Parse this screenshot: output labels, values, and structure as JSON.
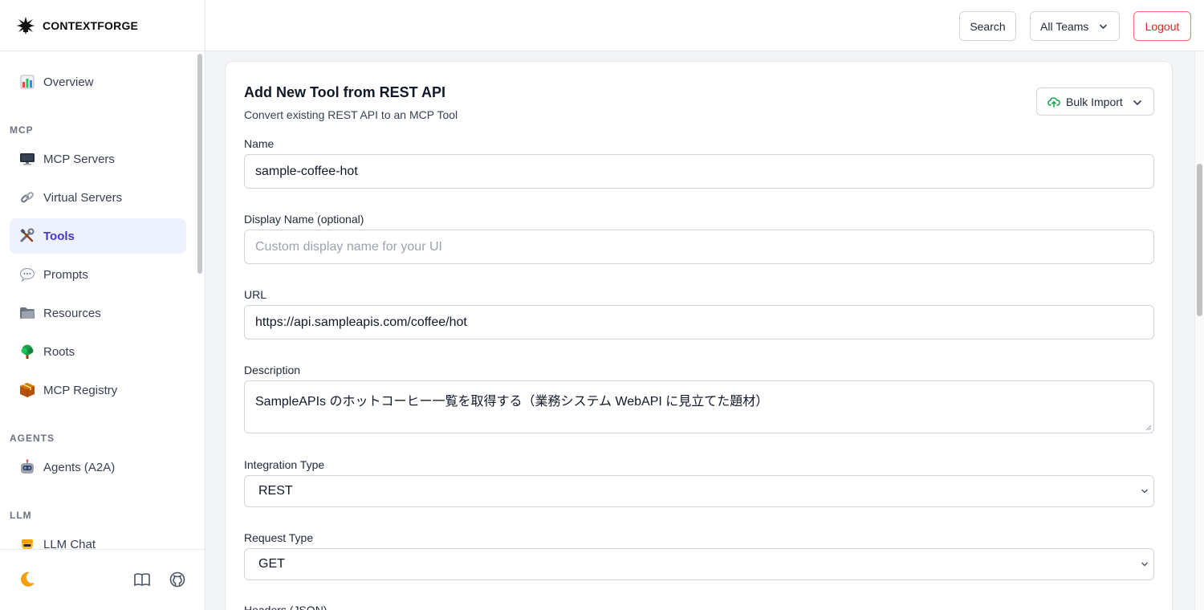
{
  "app": {
    "brand": "CONTEXTFORGE"
  },
  "header": {
    "search_label": "Search",
    "teams_label": "All Teams",
    "logout_label": "Logout"
  },
  "sidebar": {
    "overview": {
      "icon": "bar-chart-icon",
      "label": "Overview"
    },
    "sections": [
      {
        "title": "MCP",
        "items": [
          {
            "icon": "monitor-icon",
            "label": "MCP Servers"
          },
          {
            "icon": "link-icon",
            "label": "Virtual Servers"
          },
          {
            "icon": "tools-icon",
            "label": "Tools",
            "active": true
          },
          {
            "icon": "speech-bubble-icon",
            "label": "Prompts"
          },
          {
            "icon": "folder-icon",
            "label": "Resources"
          },
          {
            "icon": "tree-icon",
            "label": "Roots"
          },
          {
            "icon": "package-icon",
            "label": "MCP Registry"
          }
        ]
      },
      {
        "title": "AGENTS",
        "items": [
          {
            "icon": "robot-icon",
            "label": "Agents (A2A)"
          }
        ]
      },
      {
        "title": "LLM",
        "items": [
          {
            "icon": "chat-icon",
            "label": "LLM Chat"
          }
        ]
      }
    ],
    "footer": {
      "theme_icon": "moon-icon",
      "docs_icon": "book-icon",
      "repo_icon": "github-icon"
    }
  },
  "form": {
    "title": "Add New Tool from REST API",
    "subtitle": "Convert existing REST API to an MCP Tool",
    "bulk_import_label": "Bulk Import",
    "name": {
      "label": "Name",
      "value": "sample-coffee-hot"
    },
    "display_name": {
      "label": "Display Name (optional)",
      "placeholder": "Custom display name for your UI"
    },
    "url": {
      "label": "URL",
      "value": "https://api.sampleapis.com/coffee/hot"
    },
    "description": {
      "label": "Description",
      "value": "SampleAPIs のホットコーヒー一覧を取得する（業務システム WebAPI に見立てた題材）"
    },
    "integration_type": {
      "label": "Integration Type",
      "value": "REST"
    },
    "request_type": {
      "label": "Request Type",
      "value": "GET"
    },
    "headers": {
      "label": "Headers (JSON)"
    }
  }
}
